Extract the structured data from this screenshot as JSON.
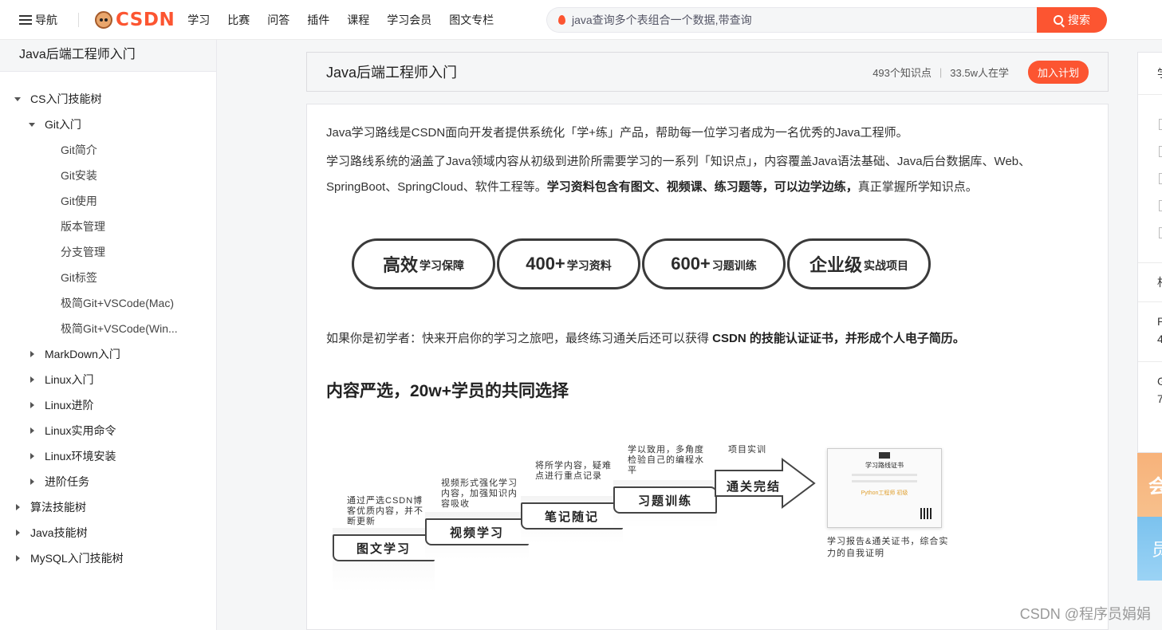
{
  "topbar": {
    "nav_label": "导航",
    "logo_text": "CSDN",
    "links": [
      "学习",
      "比赛",
      "问答",
      "插件",
      "课程",
      "学习会员",
      "图文专栏"
    ],
    "search_placeholder": "java查询多个表组合一个数据,带查询",
    "search_button": "搜索"
  },
  "sidebar": {
    "title": "Java后端工程师入门",
    "items": [
      {
        "label": "CS入门技能树",
        "level": 0,
        "state": "expanded"
      },
      {
        "label": "Git入门",
        "level": 1,
        "state": "expanded"
      },
      {
        "label": "Git简介",
        "level": 2,
        "state": "leaf"
      },
      {
        "label": "Git安装",
        "level": 2,
        "state": "leaf"
      },
      {
        "label": "Git使用",
        "level": 2,
        "state": "leaf"
      },
      {
        "label": "版本管理",
        "level": 2,
        "state": "leaf"
      },
      {
        "label": "分支管理",
        "level": 2,
        "state": "leaf"
      },
      {
        "label": "Git标签",
        "level": 2,
        "state": "leaf"
      },
      {
        "label": "极简Git+VSCode(Mac)",
        "level": 2,
        "state": "leaf"
      },
      {
        "label": "极简Git+VSCode(Win...",
        "level": 2,
        "state": "leaf"
      },
      {
        "label": "MarkDown入门",
        "level": 1,
        "state": "collapsed"
      },
      {
        "label": "Linux入门",
        "level": 1,
        "state": "collapsed"
      },
      {
        "label": "Linux进阶",
        "level": 1,
        "state": "collapsed"
      },
      {
        "label": "Linux实用命令",
        "level": 1,
        "state": "collapsed"
      },
      {
        "label": "Linux环境安装",
        "level": 1,
        "state": "collapsed"
      },
      {
        "label": "进阶任务",
        "level": 1,
        "state": "collapsed"
      },
      {
        "label": "算法技能树",
        "level": 0,
        "state": "collapsed"
      },
      {
        "label": "Java技能树",
        "level": 0,
        "state": "collapsed"
      },
      {
        "label": "MySQL入门技能树",
        "level": 0,
        "state": "collapsed"
      }
    ]
  },
  "header": {
    "title": "Java后端工程师入门",
    "knowledge_points": "493个知识点",
    "learners": "33.5w人在学",
    "join_button": "加入计划"
  },
  "content": {
    "intro": "Java学习路线是CSDN面向开发者提供系统化「学+练」产品，帮助每一位学习者成为一名优秀的Java工程师。",
    "desc_plain": "学习路线系统的涵盖了Java领域内容从初级到进阶所需要学习的一系列「知识点」，内容覆盖Java语法基础、Java后台数据库、Web、SpringBoot、SpringCloud、软件工程等。",
    "desc_bold": "学习资料包含有图文、视频课、练习题等，可以边学边练，",
    "desc_tail": "真正掌握所学知识点。",
    "pills": [
      {
        "big": "高效",
        "small": "学习保障"
      },
      {
        "big": "400+",
        "small": "学习资料"
      },
      {
        "big": "600+",
        "small": "习题训练"
      },
      {
        "big": "企业级",
        "small": "实战项目"
      }
    ],
    "beginner_plain": "如果你是初学者：快来开启你的学习之旅吧，最终练习通关后还可以获得 ",
    "beginner_bold": "CSDN 的技能认证证书，并形成个人电子简历。",
    "section_title": "内容严选，20w+学员的共同选择",
    "steps": [
      {
        "label": "图文学习",
        "desc": "通过严选CSDN博客优质内容，并不断更新"
      },
      {
        "label": "视频学习",
        "desc": "视频形式强化学习内容，加强知识内容吸收"
      },
      {
        "label": "笔记随记",
        "desc": "将所学内容，疑难点进行重点记录"
      },
      {
        "label": "习题训练",
        "desc": "学以致用，多角度检验自己的编程水平"
      },
      {
        "label": "通关完结",
        "desc": "项目实训"
      }
    ],
    "certificate": {
      "title": "学习路线证书",
      "name": "Python工程师 初级",
      "caption": "学习报告&通关证书，综合实力的自我证明"
    }
  },
  "right_panel": {
    "chars": [
      "学",
      "相",
      "P",
      "4",
      "G",
      "7"
    ],
    "banner_chars": [
      "会",
      "员"
    ]
  },
  "watermark": "CSDN @程序员娟娟",
  "colors": {
    "accent": "#fc5531",
    "text": "#222226",
    "background": "#f5f6f7"
  }
}
